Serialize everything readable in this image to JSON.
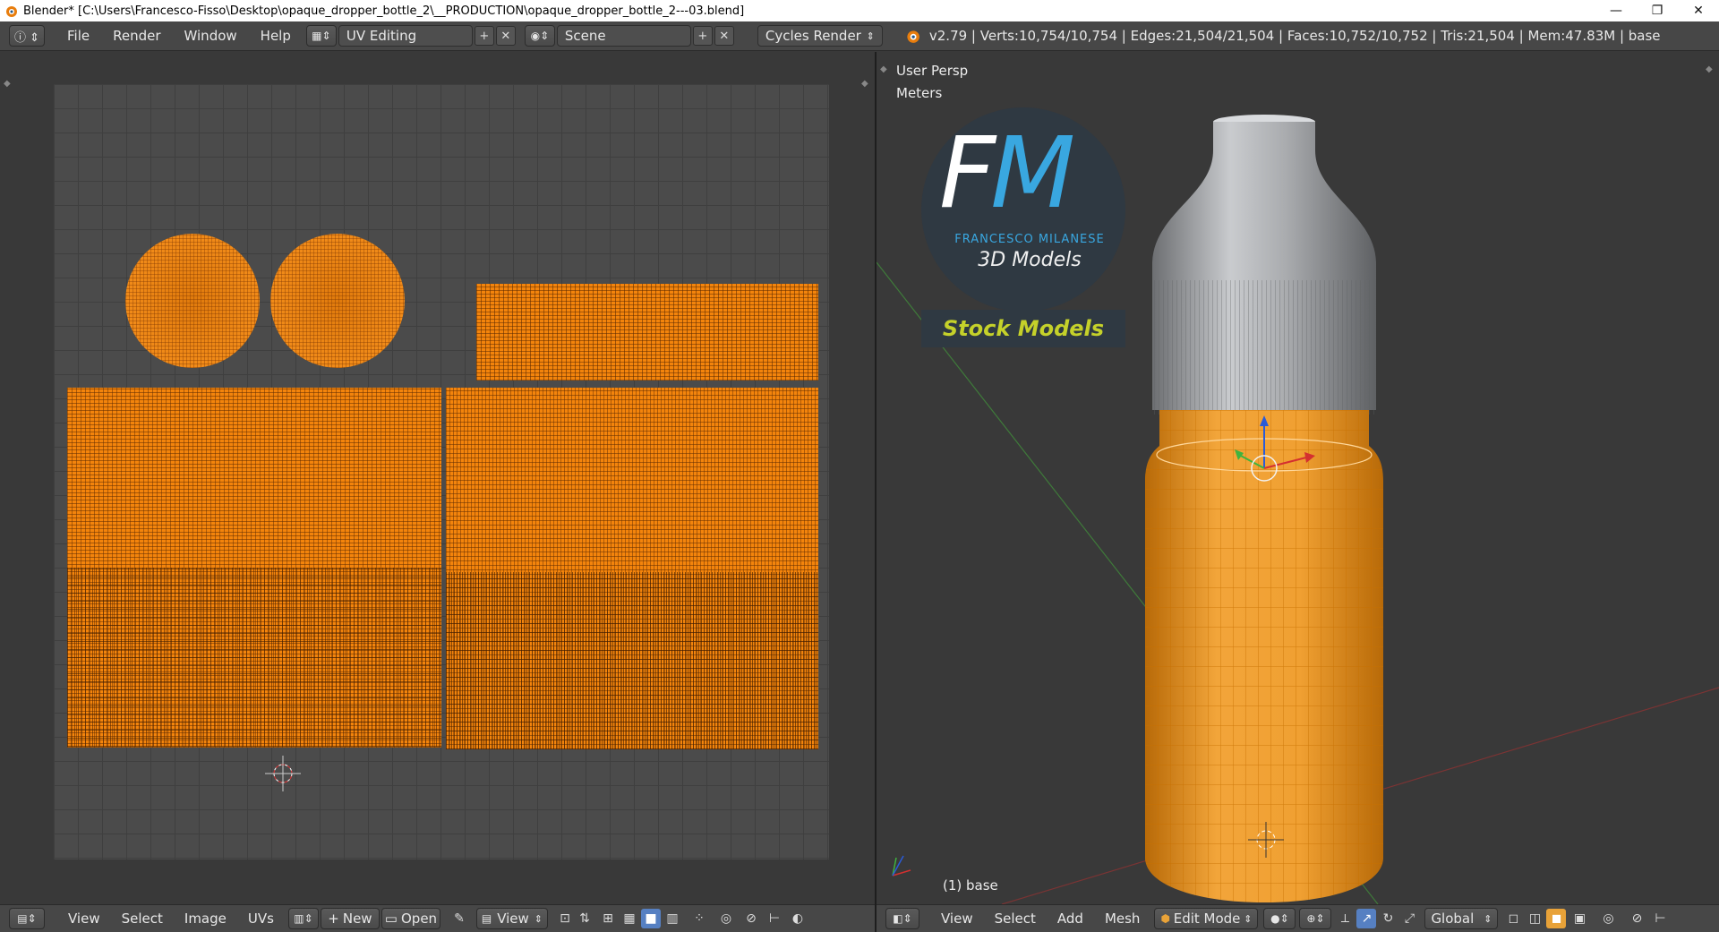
{
  "titlebar": {
    "text": "Blender* [C:\\Users\\Francesco-Fisso\\Desktop\\opaque_dropper_bottle_2\\__PRODUCTION\\opaque_dropper_bottle_2---03.blend]",
    "minimize": "—",
    "maximize": "❐",
    "close": "✕"
  },
  "info_header": {
    "menus": [
      "File",
      "Render",
      "Window",
      "Help"
    ],
    "screen_layout": "UV Editing",
    "scene": "Scene",
    "render_engine": "Cycles Render",
    "stats": "v2.79 | Verts:10,754/10,754 | Edges:21,504/21,504 | Faces:10,752/10,752 | Tris:21,504 | Mem:47.83M | base"
  },
  "viewport": {
    "view_name": "User Persp",
    "units": "Meters",
    "object_label": "(1) base",
    "logo": {
      "letters": "FM",
      "name": "FRANCESCO MILANESE",
      "subtitle": "3D Models",
      "stock": "Stock Models"
    }
  },
  "uv_bottom": {
    "menus": [
      "View",
      "Select",
      "Image",
      "UVs"
    ],
    "new_label": "New",
    "open_label": "Open",
    "view_label": "View"
  },
  "vp_bottom": {
    "menus": [
      "View",
      "Select",
      "Add",
      "Mesh"
    ],
    "mode": "Edit Mode",
    "orientation": "Global"
  },
  "colors": {
    "selection_orange": "#f3840c",
    "logo_blue": "#39a7e0",
    "stock_yellow": "#c5d12a"
  }
}
